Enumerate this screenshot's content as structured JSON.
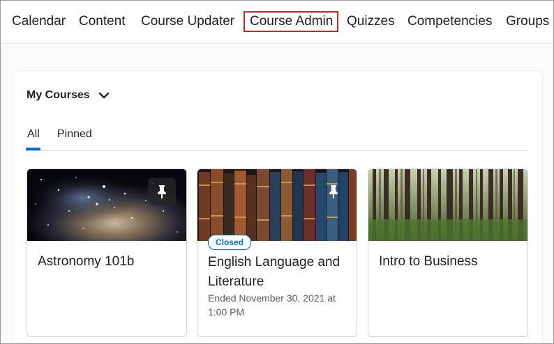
{
  "nav": {
    "items": [
      "Calendar",
      "Content",
      "Course Updater",
      "Course Admin",
      "Quizzes",
      "Competencies",
      "Groups"
    ],
    "highlighted": "Course Admin"
  },
  "widget": {
    "title": "My Courses",
    "tabs": [
      "All",
      "Pinned"
    ],
    "active_tab": "All"
  },
  "courses": [
    {
      "name": "Astronomy 101b",
      "badge": "",
      "meta": "",
      "image": "nebula-stars",
      "pinned": true
    },
    {
      "name": "English Language and Literature",
      "badge": "Closed",
      "meta": "Ended November 30, 2021 at 1:00 PM",
      "image": "old-books",
      "pinned": true
    },
    {
      "name": "Intro to Business",
      "badge": "",
      "meta": "",
      "image": "birch-forest",
      "pinned": false
    }
  ],
  "colors": {
    "accent": "#006fbf",
    "highlight_border": "#c0272d"
  }
}
